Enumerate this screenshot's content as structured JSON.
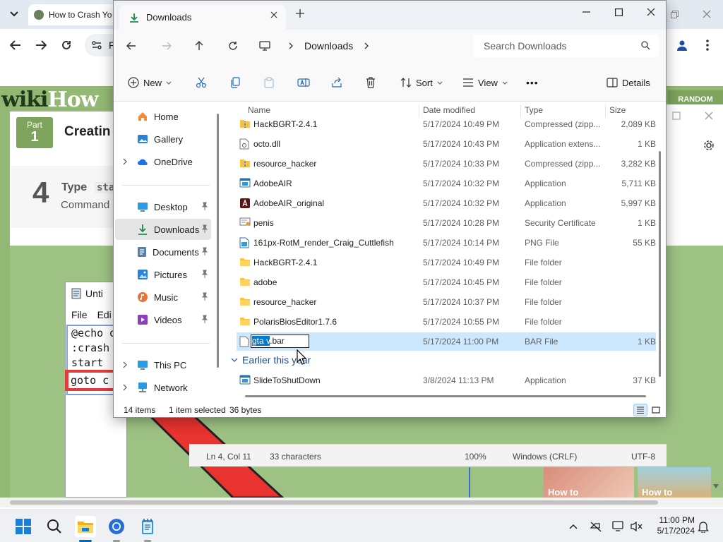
{
  "browser": {
    "tab_title": "How to Crash Yo",
    "omnibox_text": "F"
  },
  "webpage": {
    "logo_wiki": "wiki",
    "logo_how": "How",
    "random_label": "RANDOM",
    "part_label": "Part",
    "part_number": "1",
    "part_title": "Creatin",
    "step_number": "4",
    "step_type_label": "Type",
    "step_code": "sta",
    "step_command_label": "Command",
    "notepad": {
      "title": "Unti",
      "menu_file": "File",
      "menu_edit": "Edi",
      "lines": [
        "@echo o",
        ":crash",
        "start"
      ],
      "goto_line": "goto c",
      "status_pos": "Ln 4, Col 11",
      "status_chars": "33 characters",
      "status_zoom": "100%",
      "status_eol": "Windows (CRLF)",
      "status_enc": "UTF-8"
    },
    "thumb_left": "How to",
    "thumb_right": "How to"
  },
  "explorer": {
    "tab_title": "Downloads",
    "breadcrumb": "Downloads",
    "search_placeholder": "Search Downloads",
    "commands": {
      "new": "New",
      "sort": "Sort",
      "view": "View",
      "more": "•••",
      "details": "Details"
    },
    "sidebar": {
      "items": [
        {
          "label": "Home",
          "icon": "home-icon"
        },
        {
          "label": "Gallery",
          "icon": "gallery-icon"
        },
        {
          "label": "OneDrive",
          "icon": "onedrive-icon"
        },
        {
          "label": "Desktop",
          "icon": "desktop-icon"
        },
        {
          "label": "Downloads",
          "icon": "downloads-icon"
        },
        {
          "label": "Documents",
          "icon": "documents-icon"
        },
        {
          "label": "Pictures",
          "icon": "pictures-icon"
        },
        {
          "label": "Music",
          "icon": "music-icon"
        },
        {
          "label": "Videos",
          "icon": "videos-icon"
        },
        {
          "label": "This PC",
          "icon": "this-pc-icon"
        },
        {
          "label": "Network",
          "icon": "network-icon"
        }
      ]
    },
    "columns": {
      "name": "Name",
      "date": "Date modified",
      "type": "Type",
      "size": "Size"
    },
    "files": [
      {
        "name": "HackBGRT-2.4.1",
        "date": "5/17/2024 10:49 PM",
        "type": "Compressed (zipp...",
        "size": "2,089 KB",
        "icon": "zip-folder-icon"
      },
      {
        "name": "octo.dll",
        "date": "5/17/2024 10:43 PM",
        "type": "Application extens...",
        "size": "1 KB",
        "icon": "dll-file-icon"
      },
      {
        "name": "resource_hacker",
        "date": "5/17/2024 10:33 PM",
        "type": "Compressed (zipp...",
        "size": "3,282 KB",
        "icon": "zip-folder-icon"
      },
      {
        "name": "AdobeAIR",
        "date": "5/17/2024 10:32 PM",
        "type": "Application",
        "size": "5,711 KB",
        "icon": "application-icon"
      },
      {
        "name": "AdobeAIR_original",
        "date": "5/17/2024 10:32 PM",
        "type": "Application",
        "size": "5,997 KB",
        "icon": "adobe-air-icon"
      },
      {
        "name": "penis",
        "date": "5/17/2024 10:28 PM",
        "type": "Security Certificate",
        "size": "1 KB",
        "icon": "certificate-icon"
      },
      {
        "name": "161px-RotM_render_Craig_Cuttlefish",
        "date": "5/17/2024 10:14 PM",
        "type": "PNG File",
        "size": "55 KB",
        "icon": "png-file-icon"
      },
      {
        "name": "HackBGRT-2.4.1",
        "date": "5/17/2024 10:49 PM",
        "type": "File folder",
        "size": "",
        "icon": "folder-icon"
      },
      {
        "name": "adobe",
        "date": "5/17/2024 10:45 PM",
        "type": "File folder",
        "size": "",
        "icon": "folder-icon"
      },
      {
        "name": "resource_hacker",
        "date": "5/17/2024 10:37 PM",
        "type": "File folder",
        "size": "",
        "icon": "folder-icon"
      },
      {
        "name": "PolarisBiosEditor1.7.6",
        "date": "5/17/2024 10:55 PM",
        "type": "File folder",
        "size": "",
        "icon": "folder-icon"
      }
    ],
    "renaming_file": {
      "name_selected": "gta v",
      "name_ext": ".bar",
      "date": "5/17/2024 11:00 PM",
      "type": "BAR File",
      "size": "1 KB"
    },
    "group_header": "Earlier this year",
    "earlier_files": [
      {
        "name": "SlideToShutDown",
        "date": "3/8/2024 11:13 PM",
        "type": "Application",
        "size": "37 KB",
        "icon": "application-icon"
      }
    ],
    "status": {
      "items": "14 items",
      "selected": "1 item selected",
      "bytes": "36 bytes"
    }
  },
  "taskbar": {
    "time": "11:00 PM",
    "date": "5/17/2024"
  },
  "colors": {
    "accent": "#0078d4",
    "selection": "#cce8ff",
    "folder": "#f5c443",
    "wikihow_green": "#93b874"
  }
}
